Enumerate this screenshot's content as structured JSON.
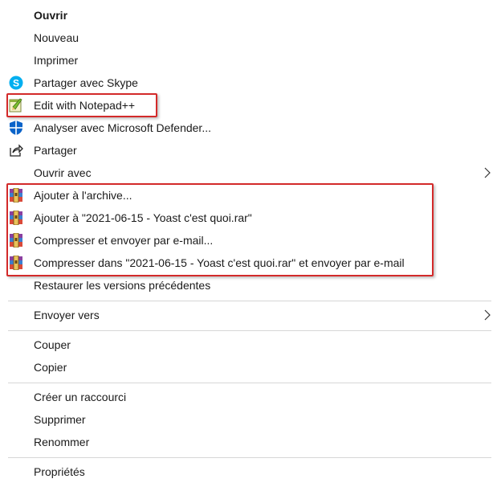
{
  "colors": {
    "highlight_border": "#d32a2a",
    "separator": "#d6d6d6",
    "skype_blue": "#00aff0",
    "defender_blue": "#0a63c9"
  },
  "menu": {
    "items": [
      {
        "label": "Ouvrir",
        "icon": null
      },
      {
        "label": "Nouveau",
        "icon": null
      },
      {
        "label": "Imprimer",
        "icon": null
      },
      {
        "label": "Partager avec Skype",
        "icon": "skype-icon"
      },
      {
        "label": "Edit with Notepad++",
        "icon": "notepad-plus-plus-icon"
      },
      {
        "label": "Analyser avec Microsoft Defender...",
        "icon": "defender-shield-icon"
      },
      {
        "label": "Partager",
        "icon": "share-icon"
      },
      {
        "label": "Ouvrir avec",
        "icon": null,
        "submenu": true
      },
      {
        "label": "Ajouter à l'archive...",
        "icon": "winrar-icon"
      },
      {
        "label": "Ajouter à \"2021-06-15 - Yoast c'est quoi.rar\"",
        "icon": "winrar-icon"
      },
      {
        "label": "Compresser et envoyer par e-mail...",
        "icon": "winrar-icon"
      },
      {
        "label": "Compresser dans \"2021-06-15 - Yoast c'est quoi.rar\" et envoyer par e-mail",
        "icon": "winrar-icon"
      },
      {
        "label": "Restaurer les versions précédentes",
        "icon": null
      },
      {
        "label": "Envoyer vers",
        "icon": null,
        "submenu": true
      },
      {
        "label": "Couper",
        "icon": null
      },
      {
        "label": "Copier",
        "icon": null
      },
      {
        "label": "Créer un raccourci",
        "icon": null
      },
      {
        "label": "Supprimer",
        "icon": null
      },
      {
        "label": "Renommer",
        "icon": null
      },
      {
        "label": "Propriétés",
        "icon": null
      }
    ]
  }
}
